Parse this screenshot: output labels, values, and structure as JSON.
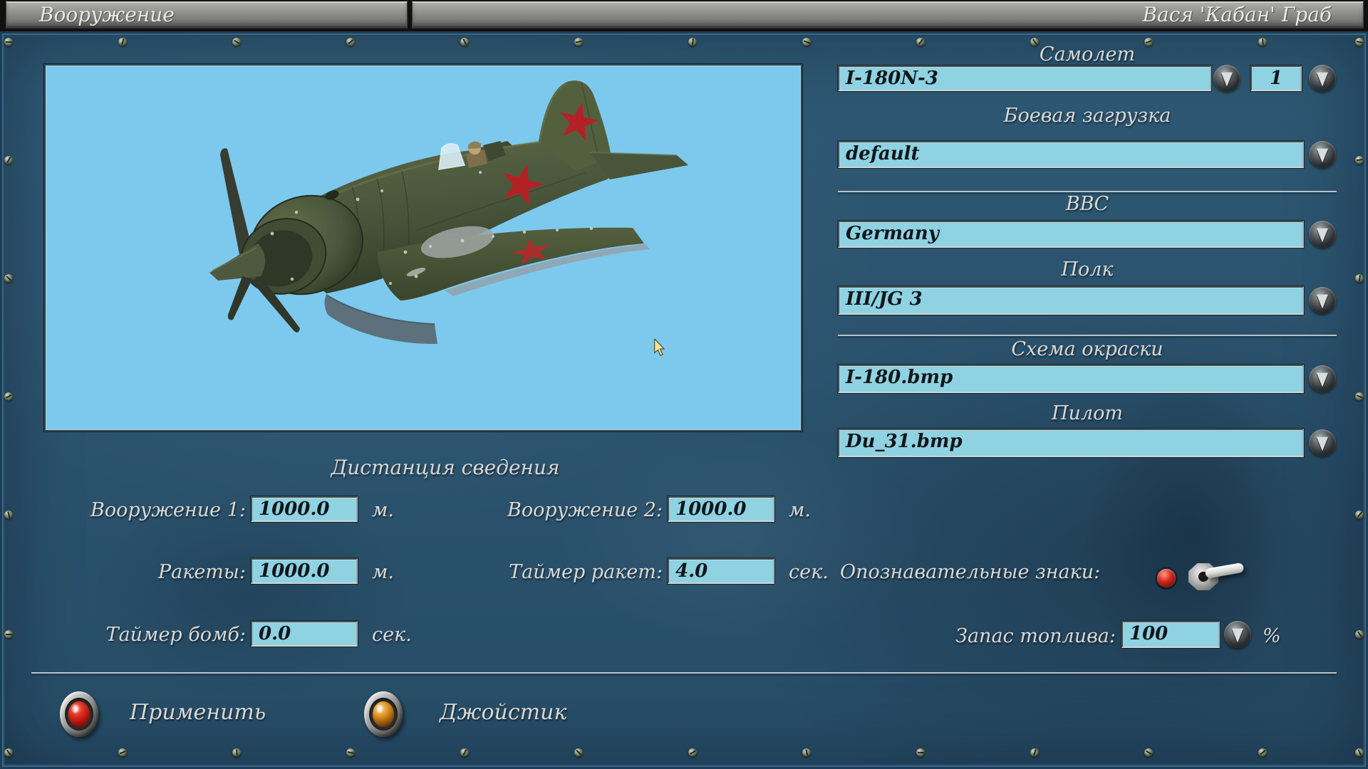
{
  "titlebar": {
    "left": "Вооружение",
    "right": "Вася 'Кабан' Граб"
  },
  "selectors": {
    "aircraft": {
      "label": "Самолет",
      "value": "I-180N-3",
      "count": "1"
    },
    "loadout": {
      "label": "Боевая загрузка",
      "value": "default"
    },
    "airforce": {
      "label": "ВВС",
      "value": "Germany"
    },
    "regiment": {
      "label": "Полк",
      "value": "III/JG 3"
    },
    "skin": {
      "label": "Схема окраски",
      "value": "I-180.bmp"
    },
    "pilot": {
      "label": "Пилот",
      "value": "Du_31.bmp"
    }
  },
  "convergence": {
    "title": "Дистанция сведения",
    "weapon1": {
      "label": "Вооружение 1:",
      "value": "1000.0",
      "unit": "м."
    },
    "weapon2": {
      "label": "Вооружение 2:",
      "value": "1000.0",
      "unit": "м."
    },
    "rockets": {
      "label": "Ракеты:",
      "value": "1000.0",
      "unit": "м."
    },
    "rocket_timer": {
      "label": "Таймер ракет:",
      "value": "4.0",
      "unit": "сек."
    },
    "bomb_timer": {
      "label": "Таймер бомб:",
      "value": "0.0",
      "unit": "сек."
    },
    "markings": {
      "label": "Опознавательные знаки:"
    },
    "fuel": {
      "label": "Запас топлива:",
      "value": "100",
      "unit": "%"
    }
  },
  "actions": {
    "apply": "Применить",
    "joystick": "Джойстик"
  },
  "icons": {
    "dropdown": "▼"
  },
  "colors": {
    "preview-sky": "#7dc9ed",
    "field-bg": "#8fd2e2",
    "label-text": "#d8d8d5",
    "value-text": "#10161a",
    "lamp-red": "#d2261c",
    "dome-amber": "#d98a1d"
  }
}
